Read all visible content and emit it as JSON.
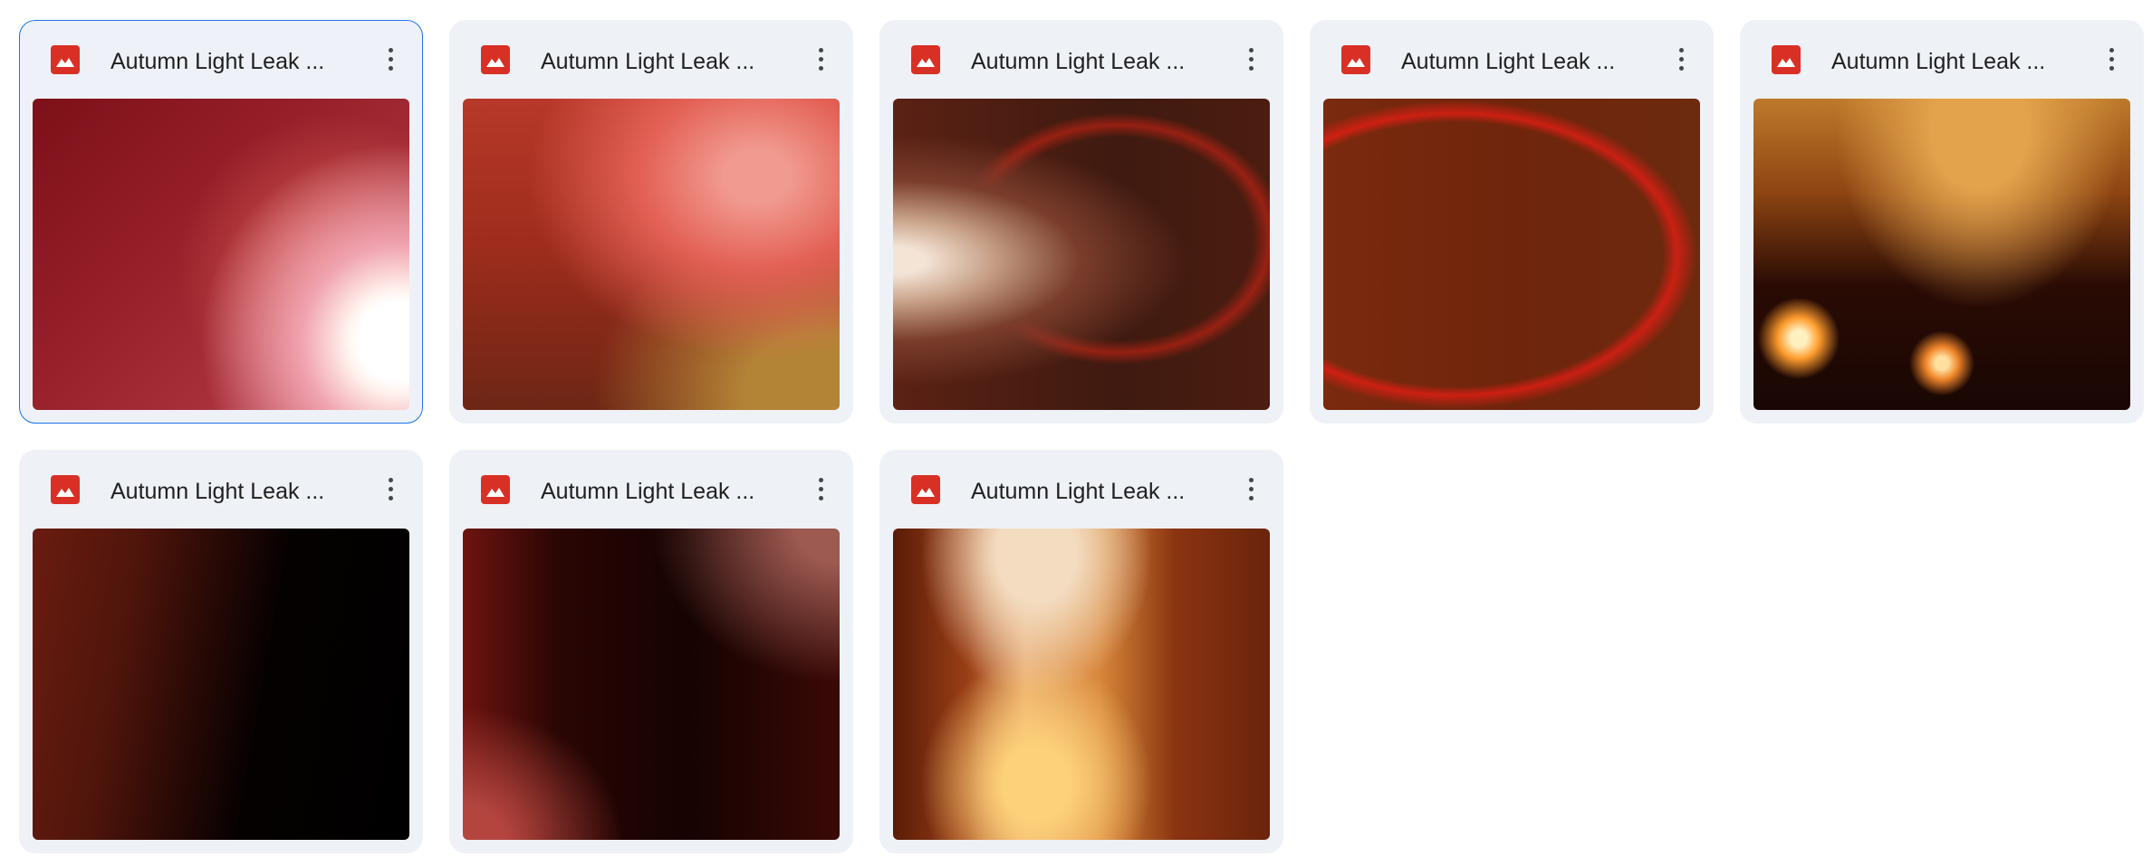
{
  "files": [
    {
      "name": "Autumn Light Leak ...",
      "selected": true
    },
    {
      "name": "Autumn Light Leak ...",
      "selected": false
    },
    {
      "name": "Autumn Light Leak ...",
      "selected": false
    },
    {
      "name": "Autumn Light Leak ...",
      "selected": false
    },
    {
      "name": "Autumn Light Leak ...",
      "selected": false
    },
    {
      "name": "Autumn Light Leak ...",
      "selected": false
    },
    {
      "name": "Autumn Light Leak ...",
      "selected": false
    },
    {
      "name": "Autumn Light Leak ...",
      "selected": false
    }
  ],
  "icons": {
    "file_type": "image-file-icon",
    "menu": "more-vert-icon"
  },
  "colors": {
    "file_icon": "#d93025",
    "selection_border": "#1a73e8",
    "card_bg": "#eef1f6"
  }
}
